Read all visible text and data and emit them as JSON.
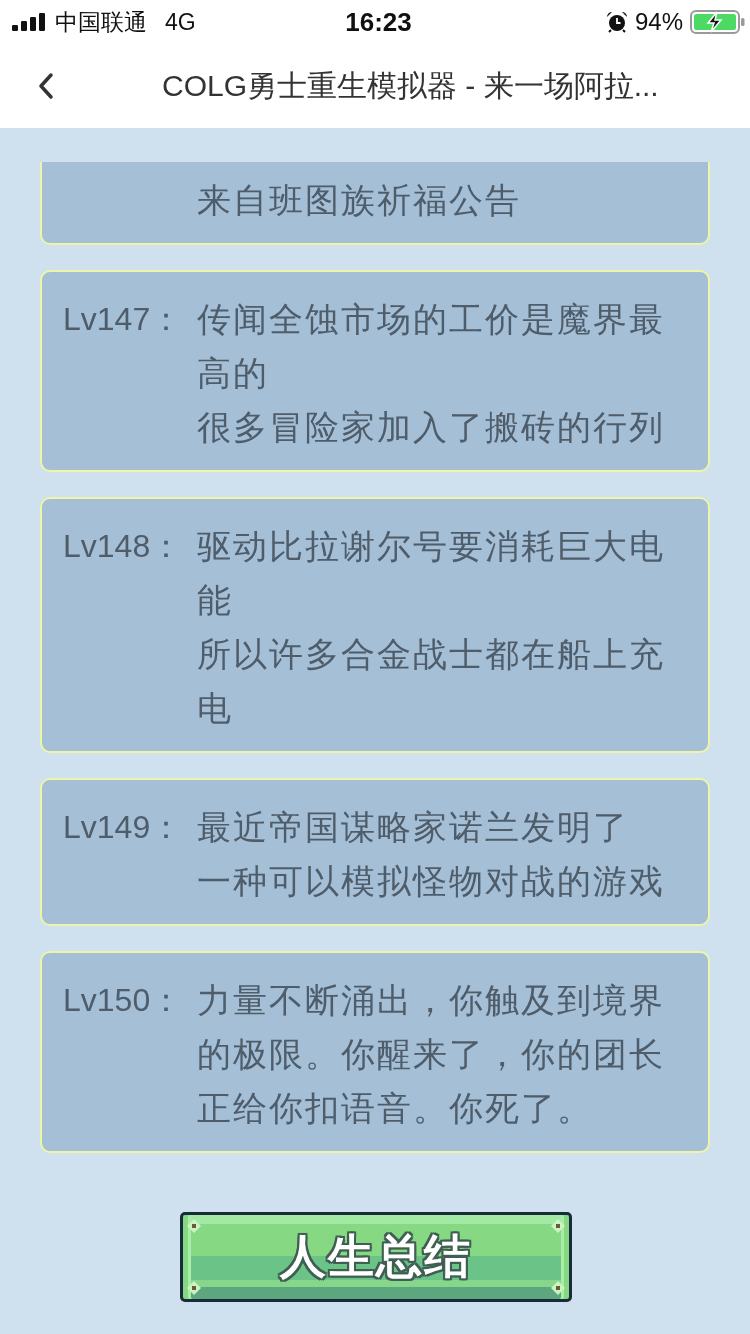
{
  "status_bar": {
    "carrier": "中国联通",
    "network": "4G",
    "time": "16:23",
    "battery": "94%"
  },
  "nav_bar": {
    "title": "COLG勇士重生模拟器 - 来一场阿拉..."
  },
  "events": [
    {
      "clipped": true,
      "lines": [
        "来自班图族祈福公告"
      ]
    },
    {
      "clipped": false,
      "label": "Lv147：",
      "lines": [
        "传闻全蚀市场的工价是魔界最高的",
        "很多冒险家加入了搬砖的行列"
      ]
    },
    {
      "clipped": false,
      "label": "Lv148：",
      "lines": [
        "驱动比拉谢尔号要消耗巨大电能",
        "所以许多合金战士都在船上充电"
      ]
    },
    {
      "clipped": false,
      "label": "Lv149：",
      "lines": [
        "最近帝国谋略家诺兰发明了",
        "一种可以模拟怪物对战的游戏"
      ]
    },
    {
      "clipped": false,
      "label": "Lv150：",
      "lines": [
        "力量不断涌出，你触及到境界的极限。你醒来了，你的团长正给你扣语音。你死了。"
      ]
    }
  ],
  "summary_button": {
    "label": "人生总结"
  }
}
